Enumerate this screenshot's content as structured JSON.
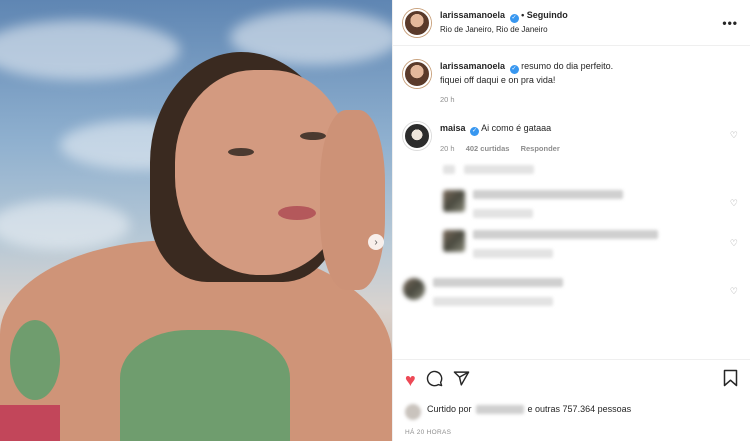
{
  "post": {
    "username": "larissamanoela",
    "verified_mark": "✓",
    "follow_separator": "•",
    "follow_status": "Seguindo",
    "location": "Rio de Janeiro, Rio de Janeiro",
    "more_icon": "•••"
  },
  "caption": {
    "username": "larissamanoela",
    "line1": "resumo do dia perfeito.",
    "line2": "fiquei off daqui e on pra vida!",
    "time": "20 h"
  },
  "comments": [
    {
      "username": "maisa",
      "text": "Ai como é gataaa",
      "time": "20 h",
      "likes": "402 curtidas",
      "reply": "Responder"
    }
  ],
  "actions": {
    "like_icon": "heart-filled",
    "comment_icon": "speech-bubble",
    "share_icon": "paper-plane",
    "save_icon": "bookmark",
    "liked_by_prefix": "Curtido por",
    "liked_by_suffix": "e outras 757.364 pessoas",
    "timestamp": "HÁ 20 HORAS"
  },
  "colors": {
    "like": "#ed4956",
    "verified": "#3897f0",
    "muted_text": "#8e8e8e"
  }
}
